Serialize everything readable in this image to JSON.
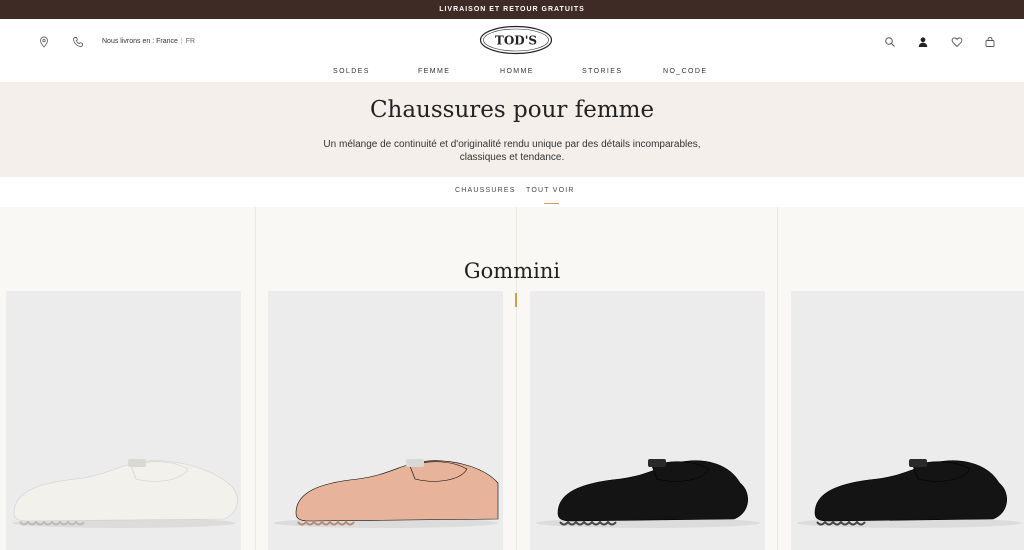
{
  "topbar": {
    "text": "LIVRAISON ET RETOUR GRATUITS"
  },
  "header": {
    "ship_label": "Nous livrons en :",
    "country": "France",
    "language": "FR",
    "logo_text": "TOD'S",
    "icons": [
      "location-icon",
      "phone-icon",
      "search-icon",
      "account-icon",
      "wishlist-icon",
      "bag-icon"
    ]
  },
  "nav": {
    "items": [
      {
        "label": "SOLDES"
      },
      {
        "label": "FEMME"
      },
      {
        "label": "HOMME"
      },
      {
        "label": "STORIES"
      },
      {
        "label": "NO_CODE"
      }
    ]
  },
  "hero": {
    "title": "Chaussures pour femme",
    "description": "Un mélange de continuité et d'originalité rendu unique par des détails incomparables, classiques et tendance."
  },
  "subnav": {
    "items": [
      {
        "label": "CHAUSSURES",
        "active": false
      },
      {
        "label": "TOUT VOIR",
        "active": true
      }
    ]
  },
  "section": {
    "title": "Gommini"
  },
  "products": [
    {
      "shoe_name": "white-patent-driving-loafer",
      "color": "#f2f1ec"
    },
    {
      "shoe_name": "nude-patent-driving-loafer",
      "color": "#e7b39a"
    },
    {
      "shoe_name": "black-patent-driving-loafer",
      "color": "#141414"
    },
    {
      "shoe_name": "black-patent-driving-loafer",
      "color": "#141414"
    }
  ],
  "colors": {
    "topbar": "#3e2b26",
    "accent": "#c9a24a",
    "hero_bg": "#f4efeb"
  }
}
